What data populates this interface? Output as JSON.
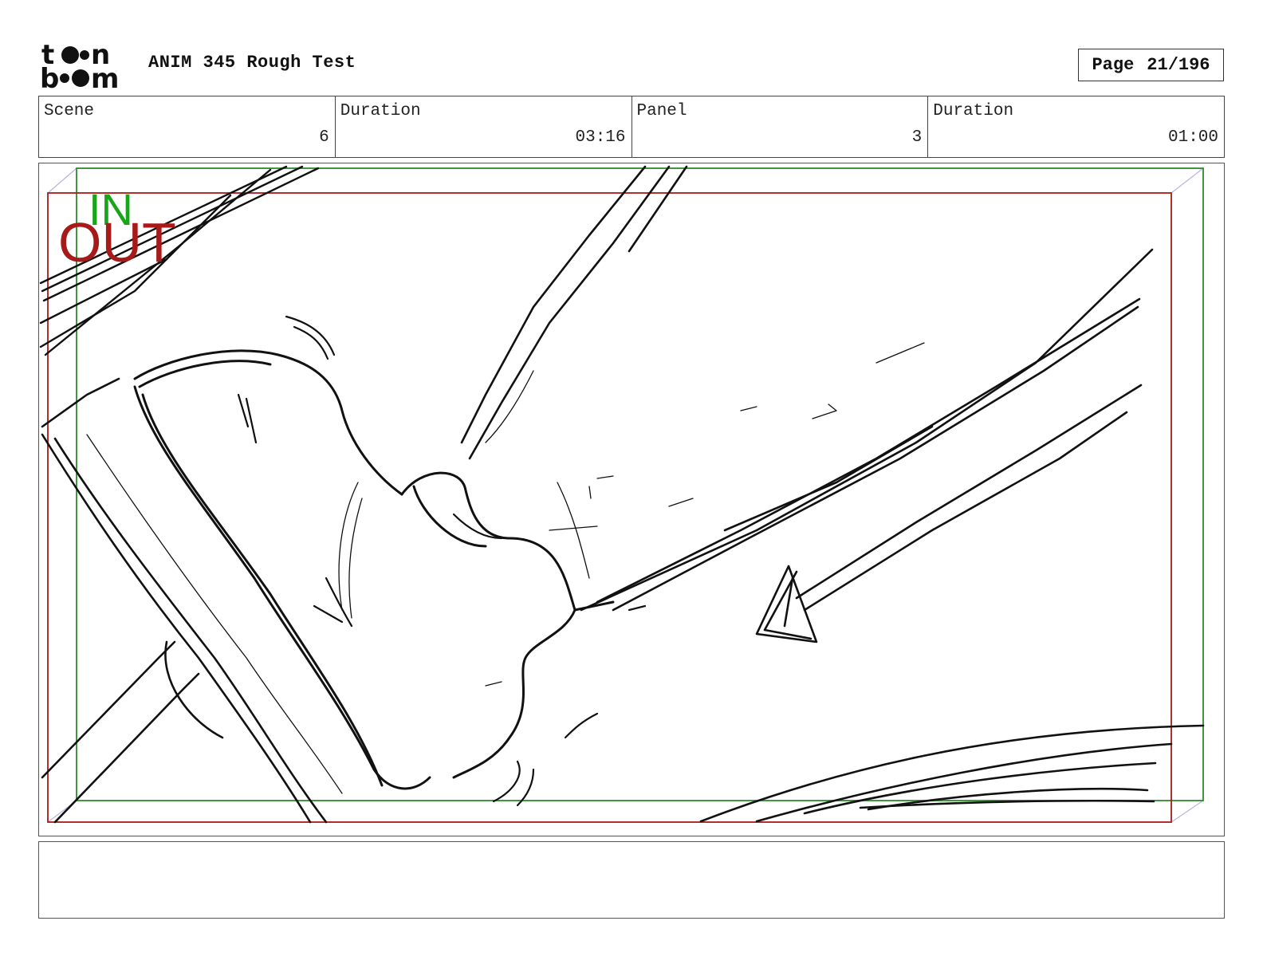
{
  "header": {
    "logo_text": "toon boom",
    "project_title": "ANIM 345 Rough Test",
    "page_label": "Page",
    "page_value": "21/196"
  },
  "info": {
    "scene_label": "Scene",
    "scene_value": "6",
    "scene_duration_label": "Duration",
    "scene_duration_value": "03:16",
    "panel_label": "Panel",
    "panel_value": "3",
    "panel_duration_label": "Duration",
    "panel_duration_value": "01:00"
  },
  "panel": {
    "in_label": "IN",
    "out_label": "OUT",
    "colors": {
      "in_frame": "#2e8b2e",
      "out_frame": "#a81a1a",
      "sketch": "#111111"
    }
  },
  "caption": {
    "text": ""
  }
}
